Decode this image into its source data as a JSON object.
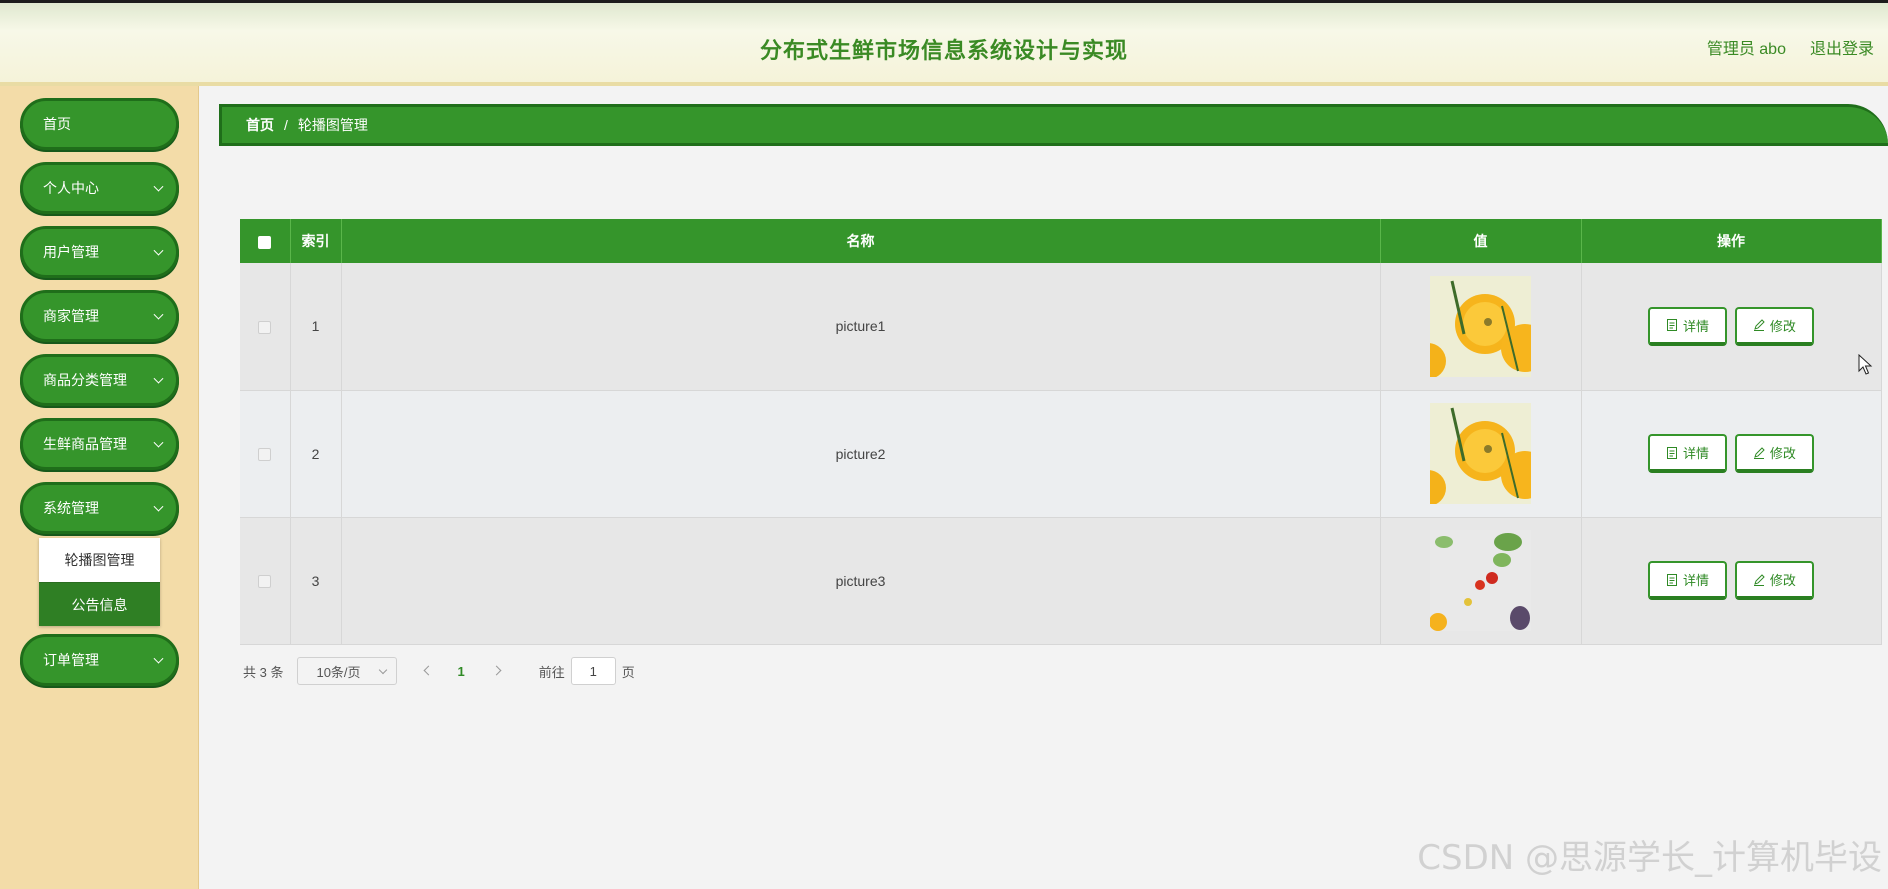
{
  "header": {
    "title": "分布式生鲜市场信息系统设计与实现",
    "user_label": "管理员 abo",
    "logout": "退出登录"
  },
  "sidebar": {
    "items": [
      {
        "label": "首页"
      },
      {
        "label": "个人中心"
      },
      {
        "label": "用户管理"
      },
      {
        "label": "商家管理"
      },
      {
        "label": "商品分类管理"
      },
      {
        "label": "生鲜商品管理"
      },
      {
        "label": "系统管理"
      },
      {
        "label": "订单管理"
      }
    ],
    "submenu": [
      {
        "label": "轮播图管理"
      },
      {
        "label": "公告信息"
      }
    ]
  },
  "breadcrumb": {
    "home": "首页",
    "separator": "/",
    "current": "轮播图管理"
  },
  "table": {
    "headers": {
      "index": "索引",
      "name": "名称",
      "value": "值",
      "actions": "操作"
    },
    "rows": [
      {
        "index": "1",
        "name": "picture1",
        "image": "orange-slices"
      },
      {
        "index": "2",
        "name": "picture2",
        "image": "orange-slices"
      },
      {
        "index": "3",
        "name": "picture3",
        "image": "vegetables"
      }
    ],
    "detail_label": "详情",
    "edit_label": "修改"
  },
  "pagination": {
    "total": "共 3 条",
    "page_size": "10条/页",
    "current_page": "1",
    "goto_label": "前往",
    "goto_value": "1",
    "page_unit": "页"
  },
  "watermark": "CSDN @思源学长_计算机毕设",
  "colors": {
    "accent": "#35952b",
    "accent_dark": "#1f6e1a",
    "sidebar_bg": "#f3dca8",
    "title": "#3a8a24"
  }
}
